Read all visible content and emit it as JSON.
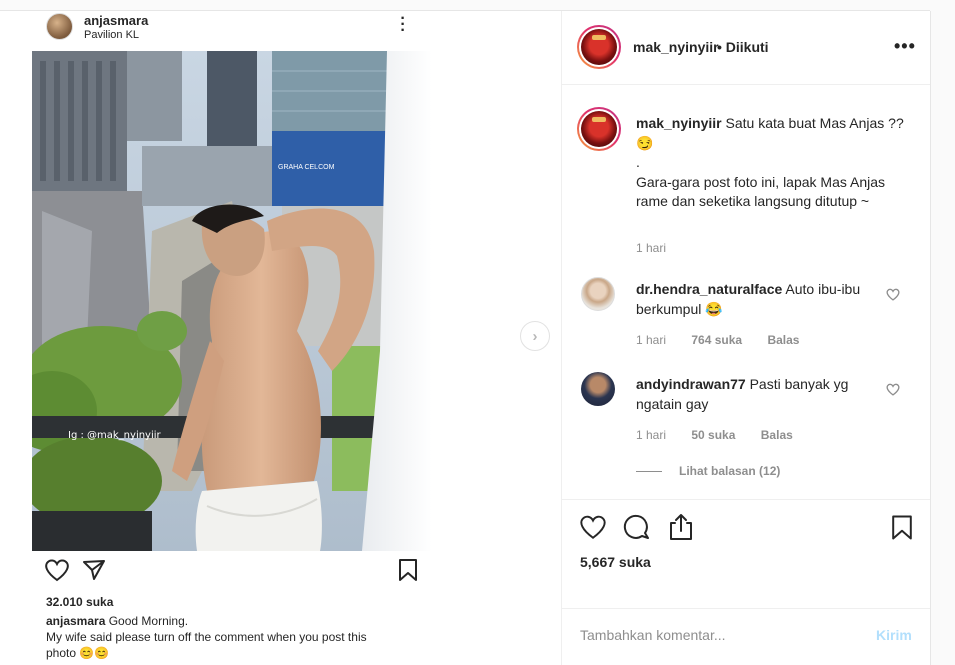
{
  "embedded_post": {
    "username": "anjasmara",
    "location": "Pavilion KL",
    "watermark": "Ig : @mak_nyinyiir",
    "likes": "32.010 suka",
    "caption_user": "anjasmara",
    "caption_line1": "Good Morning.",
    "caption_line2": "My wife said  please turn off the comment when you post this",
    "caption_line3": "photo 😊😊",
    "billboard_text": "GRAHA CELCOM"
  },
  "post_header": {
    "username": "mak_nyinyiir",
    "follow_status": "• Diikuti"
  },
  "caption": {
    "username": "mak_nyinyiir",
    "line1": "Satu kata buat Mas Anjas ?? 😏",
    "line2": ".",
    "line3": "Gara-gara post foto ini, lapak Mas Anjas rame dan seketika langsung ditutup ~",
    "time": "1 hari"
  },
  "comments": [
    {
      "username": "dr.hendra_naturalface",
      "text": "Auto ibu-ibu berkumpul 😂",
      "time": "1 hari",
      "likes": "764 suka",
      "reply": "Balas"
    },
    {
      "username": "andyindrawan77",
      "text": "Pasti banyak yg ngatain gay",
      "time": "1 hari",
      "likes": "50 suka",
      "reply": "Balas",
      "view_replies": "Lihat balasan (12)"
    }
  ],
  "footer": {
    "likes": "5,667 suka",
    "comment_placeholder": "Tambahkan komentar...",
    "post_label": "Kirim"
  },
  "icons": {
    "heart": "heart-icon",
    "comment": "comment-icon",
    "share": "share-icon",
    "bookmark": "bookmark-icon",
    "more": "more-options-icon",
    "next": "chevron-right-icon"
  },
  "colors": {
    "accent_disabled": "#b2dffc",
    "secondary_text": "#8e8e8e",
    "story_ring_start": "#f7a23b",
    "story_ring_end": "#c13584"
  }
}
